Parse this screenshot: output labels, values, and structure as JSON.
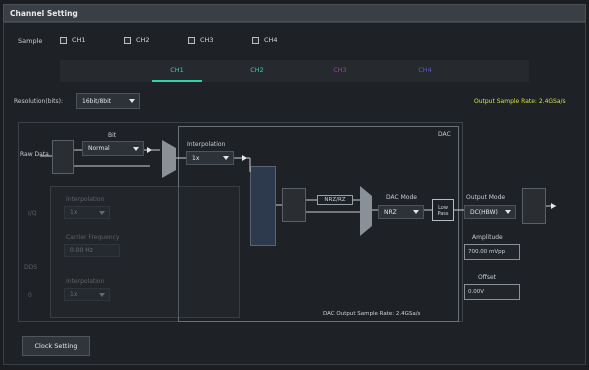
{
  "window": {
    "title": "Channel Setting"
  },
  "sample": {
    "label": "Sample",
    "channels": [
      {
        "label": "CH1"
      },
      {
        "label": "CH2"
      },
      {
        "label": "CH3"
      },
      {
        "label": "CH4"
      }
    ]
  },
  "tabs": [
    {
      "label": "CH1",
      "color": "#2fd3a9"
    },
    {
      "label": "CH2",
      "color": "#2fd3a9"
    },
    {
      "label": "CH3",
      "color": "#9b3fa8"
    },
    {
      "label": "CH4",
      "color": "#5a55c8"
    }
  ],
  "resolution": {
    "label": "Resolution(bits):",
    "value": "16bit/8bit"
  },
  "output_sample_rate": "Output Sample Rate: 2.4GSa/s",
  "diagram": {
    "raw_data_label": "Raw Data",
    "filter_label": "Bit",
    "filter_value": "Normal",
    "interpolation_label": "Interpolation",
    "interpolation_value": "1x",
    "dac_label": "DAC",
    "nrz_label": "NRZ/RZ",
    "dac_mode_label": "DAC Mode",
    "dac_mode_value": "NRZ",
    "low_pass_label": "Low Pass",
    "output_mode_label": "Output Mode",
    "output_mode_value": "DC(HBW)",
    "amplitude_label": "Amplitude",
    "amplitude_value": "700.00 mVpp",
    "offset_label": "Offset",
    "offset_value": "0.00V",
    "dac_rate": "DAC Output Sample Rate: 2.4GSa/s",
    "ghost": {
      "label_a": "Interpolation",
      "value_a": "1x",
      "label_b": "Carrier Frequency",
      "value_b": "0.00 Hz",
      "label_c": "Interpolation",
      "value_c": "1x",
      "side_a": "I/Q",
      "side_b": "DDS",
      "side_c": "0"
    }
  },
  "clock_button": "Clock Setting",
  "colors": {
    "accent": "#2fd3a9",
    "warn": "#d6e04a"
  }
}
